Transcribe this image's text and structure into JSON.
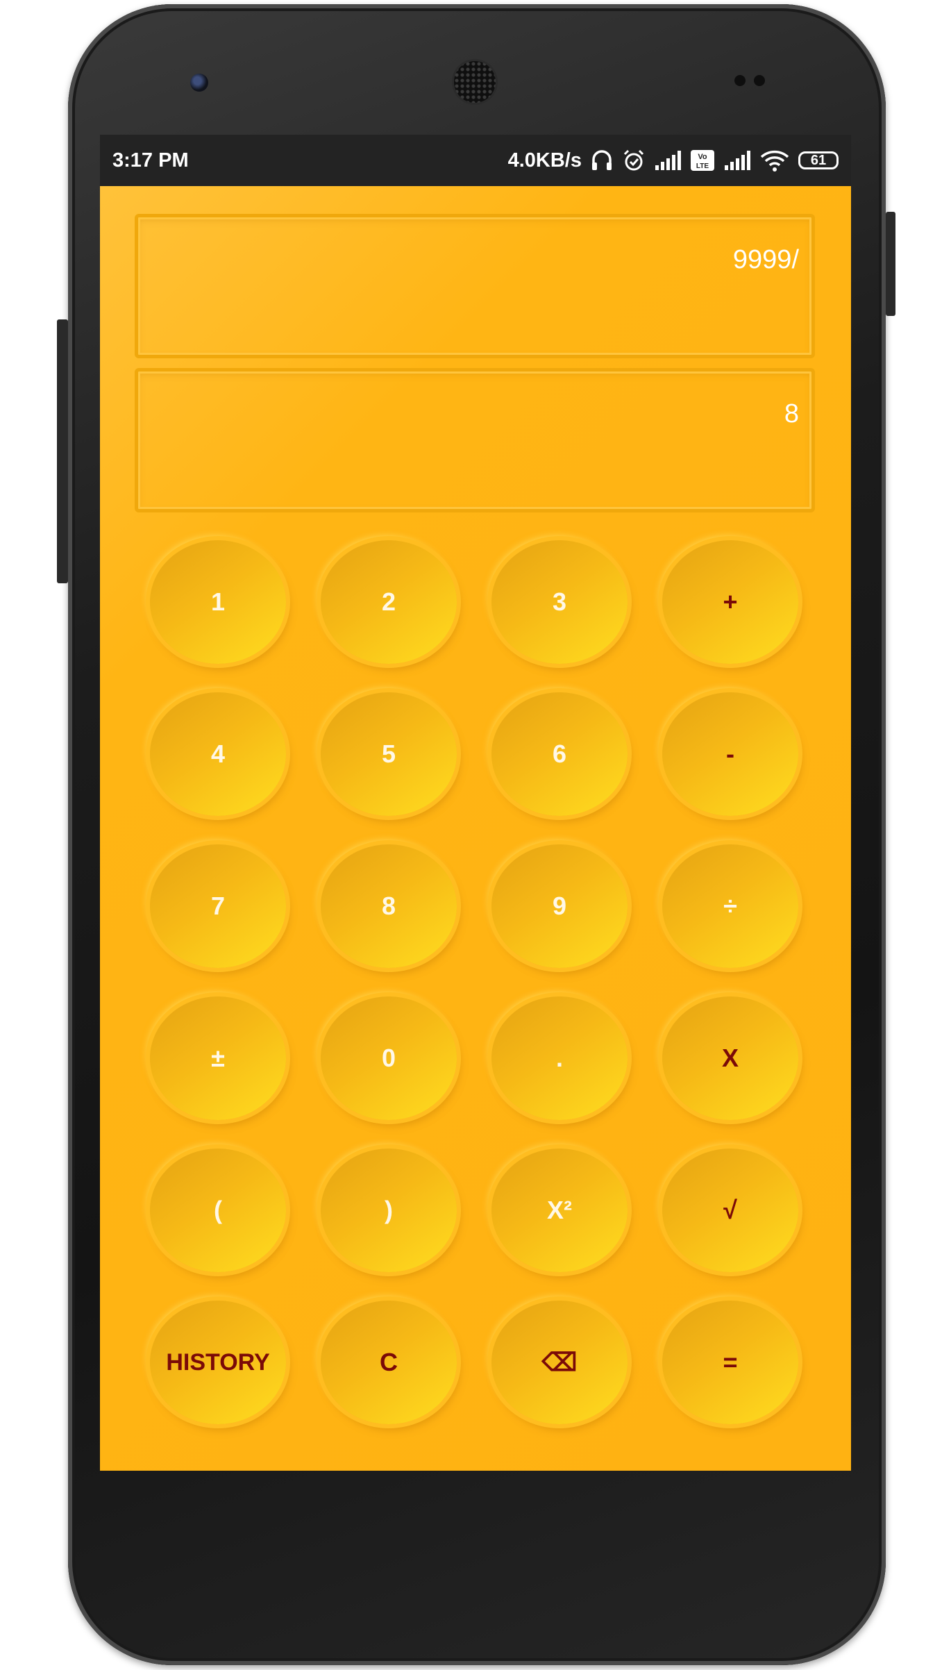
{
  "status_bar": {
    "time": "3:17 PM",
    "net_speed": "4.0KB/s",
    "battery": "61",
    "icons": [
      "headset-icon",
      "alarm-icon",
      "signal-icon",
      "volte-icon",
      "signal-icon",
      "wifi-icon",
      "battery-icon"
    ]
  },
  "display": {
    "expression": "9999/",
    "result": "8"
  },
  "keys": {
    "k1": "1",
    "k2": "2",
    "k3": "3",
    "plus": "+",
    "k4": "4",
    "k5": "5",
    "k6": "6",
    "minus": "-",
    "k7": "7",
    "k8": "8",
    "k9": "9",
    "divide": "÷",
    "plusminus": "±",
    "k0": "0",
    "dot": ".",
    "multiply": "X",
    "lparen": "(",
    "rparen": ")",
    "square": "X²",
    "sqrt": "√",
    "history": "HISTORY",
    "clear": "C",
    "backspace": "⌫",
    "equals": "="
  },
  "colors": {
    "background": "#ffb514",
    "key_text": "#fff8e8",
    "operator_text": "#7a0a08",
    "status_bar": "#232323"
  }
}
